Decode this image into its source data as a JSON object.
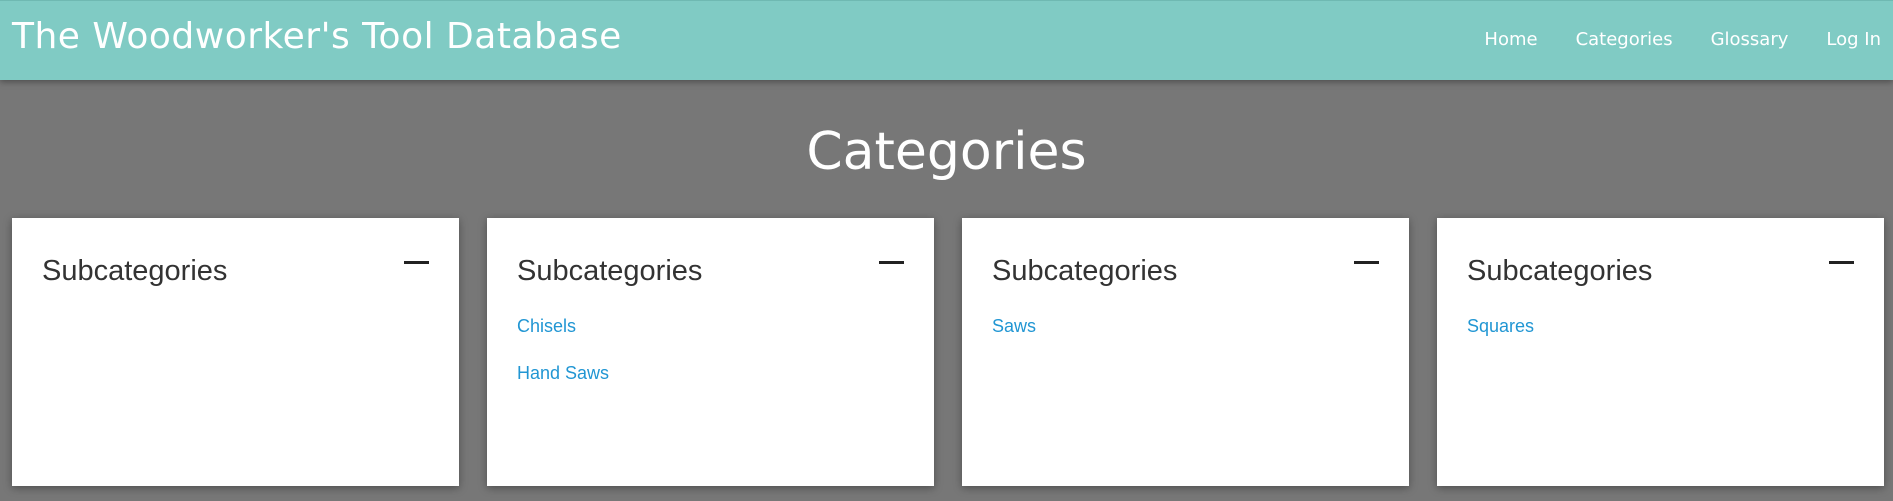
{
  "header": {
    "brand": "The Woodworker's Tool Database",
    "nav": [
      "Home",
      "Categories",
      "Glossary",
      "Log In"
    ],
    "background": "#80cbc4"
  },
  "page": {
    "title": "Categories",
    "background": "#777777"
  },
  "cards": [
    {
      "title": "Subcategories",
      "links": []
    },
    {
      "title": "Subcategories",
      "links": [
        "Chisels",
        "Hand Saws"
      ]
    },
    {
      "title": "Subcategories",
      "links": [
        "Saws"
      ]
    },
    {
      "title": "Subcategories",
      "links": [
        "Squares"
      ]
    }
  ],
  "link_color": "#2196d3"
}
